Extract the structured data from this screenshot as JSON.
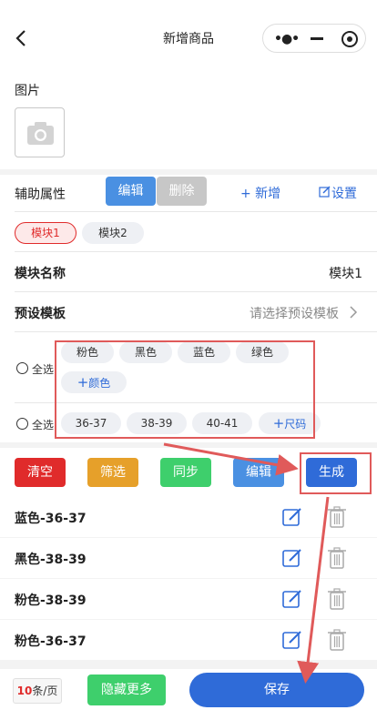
{
  "header": {
    "title": "新增商品",
    "menu_icon": "more-dots-icon",
    "minimize_icon": "minimize-icon",
    "close_icon": "target-icon"
  },
  "image_section": {
    "label": "图片",
    "placeholder_icon": "camera-icon"
  },
  "aux": {
    "label": "辅助属性",
    "edit_btn": "编辑",
    "delete_btn": "删除",
    "add_link": "+ 新增",
    "settings_link": "设置"
  },
  "modules": [
    {
      "label": "模块1",
      "active": true
    },
    {
      "label": "模块2",
      "active": false
    }
  ],
  "module_name": {
    "label": "模块名称",
    "value": "模块1"
  },
  "preset": {
    "label": "预设模板",
    "placeholder": "请选择预设模板"
  },
  "colors": {
    "select_all": "全选",
    "items": [
      "粉色",
      "黑色",
      "蓝色",
      "绿色"
    ],
    "add": "颜色"
  },
  "sizes": {
    "select_all": "全选",
    "items": [
      "36-37",
      "38-39",
      "40-41"
    ],
    "add": "尺码"
  },
  "actions": {
    "clear": "清空",
    "filter": "筛选",
    "sync": "同步",
    "edit": "编辑",
    "generate": "生成"
  },
  "sku_rows": [
    {
      "name": "蓝色-36-37"
    },
    {
      "name": "黑色-38-39"
    },
    {
      "name": "粉色-38-39"
    },
    {
      "name": "粉色-36-37"
    }
  ],
  "footer": {
    "per_page_num": "10",
    "per_page_unit": "条/页",
    "hide_more": "隐藏更多",
    "save": "保存"
  },
  "colors_theme": {
    "blue": "#4a90e2",
    "gray_btn": "#c7c7c7",
    "red": "#e02b2b",
    "orange": "#e6a02a",
    "green": "#3ecf6c",
    "primary": "#2f6bd8",
    "annotation": "#e05a5a"
  }
}
